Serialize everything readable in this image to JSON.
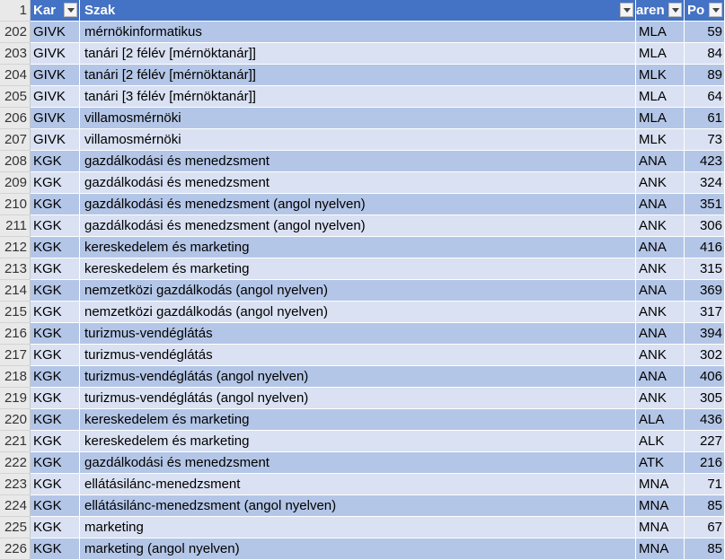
{
  "header": {
    "row_number": "1",
    "columns": [
      "Kar",
      "Szak",
      "Karen",
      "Po"
    ],
    "visible": [
      "Kar",
      "Szak",
      "aren",
      "Po"
    ]
  },
  "rows": [
    {
      "n": "202",
      "kar": "GIVK",
      "szak": "mérnökinformatikus",
      "k": "MLA",
      "po": "59"
    },
    {
      "n": "203",
      "kar": "GIVK",
      "szak": "tanári [2 félév [mérnöktanár]]",
      "k": "MLA",
      "po": "84"
    },
    {
      "n": "204",
      "kar": "GIVK",
      "szak": "tanári [2 félév [mérnöktanár]]",
      "k": "MLK",
      "po": "89"
    },
    {
      "n": "205",
      "kar": "GIVK",
      "szak": "tanári [3 félév [mérnöktanár]]",
      "k": "MLA",
      "po": "64"
    },
    {
      "n": "206",
      "kar": "GIVK",
      "szak": "villamosmérnöki",
      "k": "MLA",
      "po": "61"
    },
    {
      "n": "207",
      "kar": "GIVK",
      "szak": "villamosmérnöki",
      "k": "MLK",
      "po": "73"
    },
    {
      "n": "208",
      "kar": "KGK",
      "szak": "gazdálkodási és menedzsment",
      "k": "ANA",
      "po": "423"
    },
    {
      "n": "209",
      "kar": "KGK",
      "szak": "gazdálkodási és menedzsment",
      "k": "ANK",
      "po": "324"
    },
    {
      "n": "210",
      "kar": "KGK",
      "szak": "gazdálkodási és menedzsment (angol nyelven)",
      "k": "ANA",
      "po": "351"
    },
    {
      "n": "211",
      "kar": "KGK",
      "szak": "gazdálkodási és menedzsment (angol nyelven)",
      "k": "ANK",
      "po": "306"
    },
    {
      "n": "212",
      "kar": "KGK",
      "szak": "kereskedelem és marketing",
      "k": "ANA",
      "po": "416"
    },
    {
      "n": "213",
      "kar": "KGK",
      "szak": "kereskedelem és marketing",
      "k": "ANK",
      "po": "315"
    },
    {
      "n": "214",
      "kar": "KGK",
      "szak": "nemzetközi gazdálkodás (angol nyelven)",
      "k": "ANA",
      "po": "369"
    },
    {
      "n": "215",
      "kar": "KGK",
      "szak": "nemzetközi gazdálkodás (angol nyelven)",
      "k": "ANK",
      "po": "317"
    },
    {
      "n": "216",
      "kar": "KGK",
      "szak": "turizmus-vendéglátás",
      "k": "ANA",
      "po": "394"
    },
    {
      "n": "217",
      "kar": "KGK",
      "szak": "turizmus-vendéglátás",
      "k": "ANK",
      "po": "302"
    },
    {
      "n": "218",
      "kar": "KGK",
      "szak": "turizmus-vendéglátás (angol nyelven)",
      "k": "ANA",
      "po": "406"
    },
    {
      "n": "219",
      "kar": "KGK",
      "szak": "turizmus-vendéglátás (angol nyelven)",
      "k": "ANK",
      "po": "305"
    },
    {
      "n": "220",
      "kar": "KGK",
      "szak": "kereskedelem és marketing",
      "k": "ALA",
      "po": "436"
    },
    {
      "n": "221",
      "kar": "KGK",
      "szak": "kereskedelem és marketing",
      "k": "ALK",
      "po": "227"
    },
    {
      "n": "222",
      "kar": "KGK",
      "szak": "gazdálkodási és menedzsment",
      "k": "ATK",
      "po": "216"
    },
    {
      "n": "223",
      "kar": "KGK",
      "szak": "ellátásilánc-menedzsment",
      "k": "MNA",
      "po": "71"
    },
    {
      "n": "224",
      "kar": "KGK",
      "szak": "ellátásilánc-menedzsment (angol nyelven)",
      "k": "MNA",
      "po": "85"
    },
    {
      "n": "225",
      "kar": "KGK",
      "szak": "marketing",
      "k": "MNA",
      "po": "67"
    },
    {
      "n": "226",
      "kar": "KGK",
      "szak": "marketing (angol nyelven)",
      "k": "MNA",
      "po": "85"
    }
  ],
  "colors": {
    "header": "#4472c4",
    "band_dark": "#b4c6e7",
    "band_light": "#d9e1f2",
    "row_header": "#e9e9e9"
  }
}
